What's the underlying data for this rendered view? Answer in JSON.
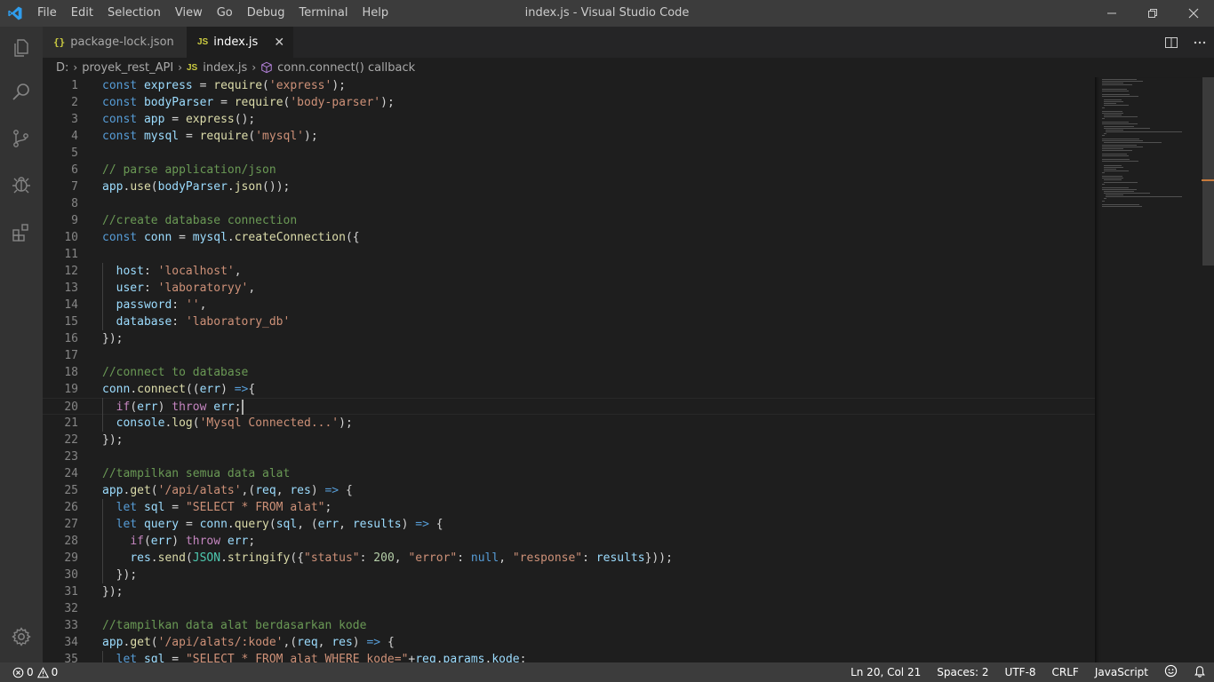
{
  "window": {
    "title": "index.js - Visual Studio Code",
    "menu": [
      "File",
      "Edit",
      "Selection",
      "View",
      "Go",
      "Debug",
      "Terminal",
      "Help"
    ]
  },
  "tabs": [
    {
      "label": "package-lock.json",
      "icon": "json-file-icon",
      "active": false
    },
    {
      "label": "index.js",
      "icon": "js-file-icon",
      "active": true
    }
  ],
  "breadcrumb": {
    "drive": "D:",
    "folder": "proyek_rest_API",
    "file": "index.js",
    "symbol": "conn.connect() callback"
  },
  "editor": {
    "language": "javascript",
    "current_line": 20,
    "lines": [
      "const express = require('express');",
      "const bodyParser = require('body-parser');",
      "const app = express();",
      "const mysql = require('mysql');",
      "",
      "// parse application/json",
      "app.use(bodyParser.json());",
      "",
      "//create database connection",
      "const conn = mysql.createConnection({",
      "",
      "  host: 'localhost',",
      "  user: 'laboratoryy',",
      "  password: '',",
      "  database: 'laboratory_db'",
      "});",
      "",
      "//connect to database",
      "conn.connect((err) =>{",
      "  if(err) throw err;",
      "  console.log('Mysql Connected...');",
      "});",
      "",
      "//tampilkan semua data alat",
      "app.get('/api/alats',(req, res) => {",
      "  let sql = \"SELECT * FROM alat\";",
      "  let query = conn.query(sql, (err, results) => {",
      "    if(err) throw err;",
      "    res.send(JSON.stringify({\"status\": 200, \"error\": null, \"response\": results}));",
      "  });",
      "});",
      "",
      "//tampilkan data alat berdasarkan kode",
      "app.get('/api/alats/:kode',(req, res) => {",
      "  let sql = \"SELECT * FROM alat WHERE kode=\"+req.params.kode;"
    ]
  },
  "statusbar": {
    "errors": "0",
    "warnings": "0",
    "position": "Ln 20, Col 21",
    "spaces": "Spaces: 2",
    "encoding": "UTF-8",
    "eol": "CRLF",
    "language": "JavaScript"
  },
  "colors": {
    "keyword": "#569cd6",
    "function": "#dcdcaa",
    "variable": "#9cdcfe",
    "string": "#ce9178",
    "comment": "#6a9955",
    "number": "#b5cea8",
    "class": "#4ec9b0",
    "statusbar": "#3c3c3c"
  }
}
